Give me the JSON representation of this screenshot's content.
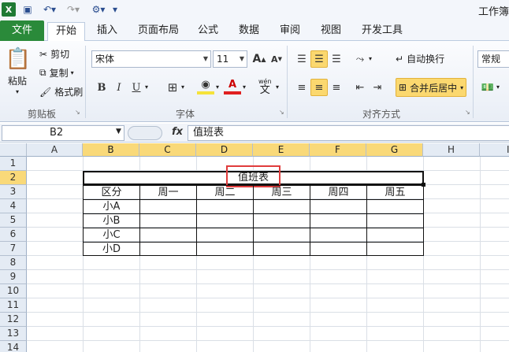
{
  "qat": {
    "save_icon": "save-icon",
    "undo_icon": "undo-icon",
    "redo_icon": "redo-icon",
    "title": "工作簿"
  },
  "tabs": [
    "文件",
    "开始",
    "插入",
    "页面布局",
    "公式",
    "数据",
    "审阅",
    "视图",
    "开发工具"
  ],
  "clipboard": {
    "paste": "粘贴",
    "cut": "剪切",
    "copy": "复制",
    "format_painter": "格式刷",
    "label": "剪贴板"
  },
  "font": {
    "name": "宋体",
    "size": "11",
    "bold": "B",
    "italic": "I",
    "underline": "U",
    "wen": "wén",
    "wen_char": "文",
    "grow": "A",
    "shrink": "A",
    "label": "字体"
  },
  "alignment": {
    "wrap": "自动换行",
    "merge": "合并后居中",
    "label": "对齐方式"
  },
  "number": {
    "format": "常规"
  },
  "formula_bar": {
    "name_box": "B2",
    "fx": "fx",
    "content": "值班表"
  },
  "columns": [
    "A",
    "B",
    "C",
    "D",
    "E",
    "F",
    "G",
    "H",
    "I"
  ],
  "rows": [
    "1",
    "2",
    "3",
    "4",
    "5",
    "6",
    "7",
    "8",
    "9",
    "10",
    "11",
    "12",
    "13",
    "14"
  ],
  "sheet": {
    "title": "值班表",
    "header": [
      "区分",
      "周一",
      "周二",
      "周三",
      "周四",
      "周五"
    ],
    "people": [
      "小A",
      "小B",
      "小C",
      "小D"
    ]
  },
  "colors": {
    "file_tab": "#2a8a3a",
    "selected_header": "#f9d979",
    "highlight_box": "#e03c3c"
  }
}
